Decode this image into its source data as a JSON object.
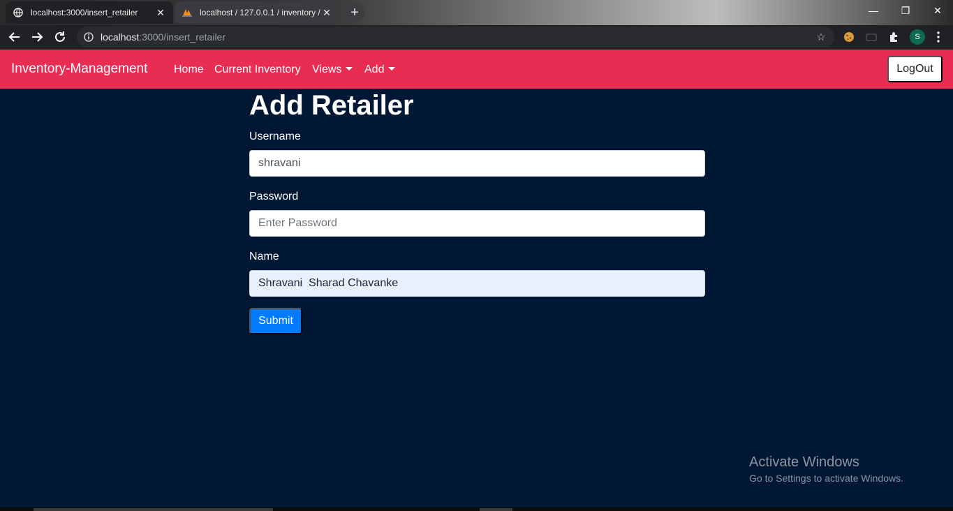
{
  "browser": {
    "tabs": [
      {
        "title": "localhost:3000/insert_retailer",
        "active": true
      },
      {
        "title": "localhost / 127.0.0.1 / inventory / ",
        "active": false
      }
    ],
    "url_host": "localhost",
    "url_path": ":3000/insert_retailer",
    "profile_initial": "S"
  },
  "navbar": {
    "brand": "Inventory-Management",
    "links": [
      "Home",
      "Current Inventory",
      "Views",
      "Add"
    ],
    "logout_label": "LogOut"
  },
  "form": {
    "title": "Add Retailer",
    "username_label": "Username",
    "username_value": "shravani",
    "password_label": "Password",
    "password_placeholder": "Enter Password",
    "name_label": "Name",
    "name_value": "Shravani  Sharad Chavanke",
    "submit_label": "Submit"
  },
  "watermark": {
    "line1": "Activate Windows",
    "line2": "Go to Settings to activate Windows."
  },
  "colors": {
    "navbar_bg": "#e92c52",
    "page_bg": "#001834",
    "submit_bg": "#007bff"
  }
}
